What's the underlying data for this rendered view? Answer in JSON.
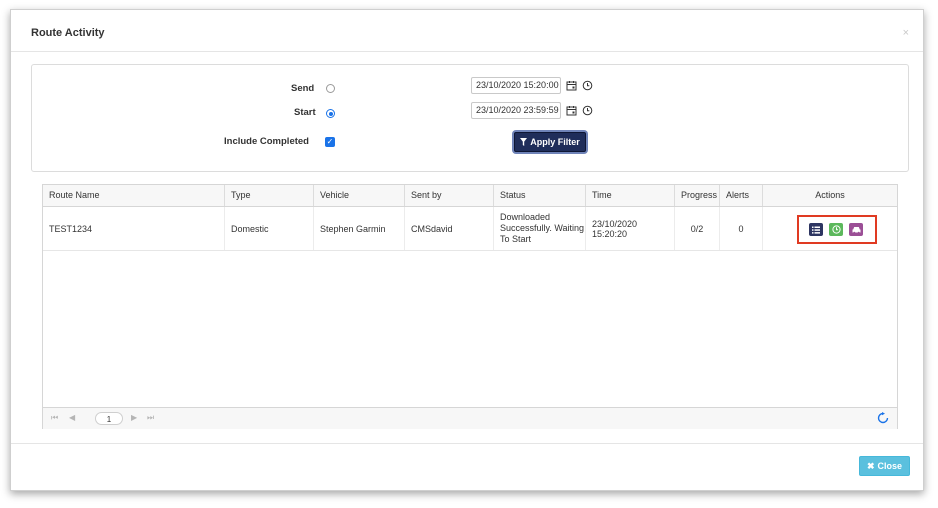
{
  "modal": {
    "title": "Route Activity",
    "close_x": "×"
  },
  "filters": {
    "send_label": "Send",
    "start_label": "Start",
    "include_completed_label": "Include Completed",
    "send_selected": false,
    "start_selected": true,
    "include_completed_checked": true,
    "send_date": "23/10/2020 15:20:00",
    "start_date": "23/10/2020 23:59:59",
    "apply_label": "Apply Filter"
  },
  "grid": {
    "columns": [
      "Route Name",
      "Type",
      "Vehicle",
      "Sent by",
      "Status",
      "Time",
      "Progress",
      "Alerts",
      "Actions"
    ],
    "rows": [
      {
        "route_name": "TEST1234",
        "type": "Domestic",
        "vehicle": "Stephen Garmin",
        "sent_by": "CMSdavid",
        "status_lines": [
          "Downloaded",
          "Successfully. Waiting",
          "To Start"
        ],
        "time": "23/10/2020 15:20:20",
        "progress": "0/2",
        "alerts": "0"
      }
    ],
    "pager": {
      "first": "⏮",
      "prev": "◀",
      "page": "1",
      "next": "▶",
      "last": "⏭"
    }
  },
  "footer": {
    "close_label": "Close"
  },
  "colors": {
    "apply_button": "#1f2d5a",
    "close_button": "#5bc0de",
    "action_list": "#2d3561",
    "action_clock": "#5cb85c",
    "action_vehicle": "#9b4f96",
    "highlight_box": "#e03a22",
    "accent": "#1a73e8"
  },
  "icons": {
    "apply": "filter-icon",
    "close": "close-x-icon",
    "actions": [
      "list-icon",
      "clock-icon",
      "vehicle-icon"
    ],
    "refresh": "refresh-icon"
  }
}
